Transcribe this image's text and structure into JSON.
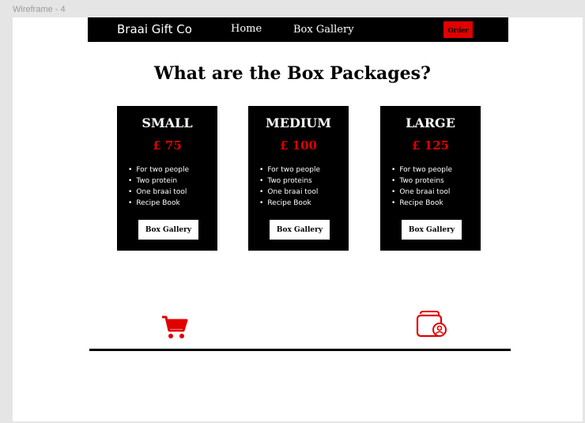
{
  "frame_label": "Wireframe - 4",
  "nav": {
    "brand": "Braai Gift Co",
    "links": [
      "Home",
      "Box Gallery"
    ],
    "order_label": "Order"
  },
  "heading": "What are the Box Packages?",
  "packages": [
    {
      "name": "SMALL",
      "price": "£ 75",
      "features": [
        "For two people",
        "Two protein",
        "One braai tool",
        "Recipe Book"
      ],
      "button": "Box Gallery"
    },
    {
      "name": "MEDIUM",
      "price": "£ 100",
      "features": [
        "For two people",
        "Two proteins",
        "One braai tool",
        "Recipe Book"
      ],
      "button": "Box Gallery"
    },
    {
      "name": "LARGE",
      "price": "£ 125",
      "features": [
        "For two people",
        "Two proteins",
        "One braai tool",
        "Recipe Book"
      ],
      "button": "Box Gallery"
    }
  ],
  "icons": {
    "cart": "shopping-cart-icon",
    "wallet": "wallet-icon"
  },
  "colors": {
    "accent": "#e00000",
    "card_bg": "#000000",
    "page_bg": "#ffffff"
  }
}
